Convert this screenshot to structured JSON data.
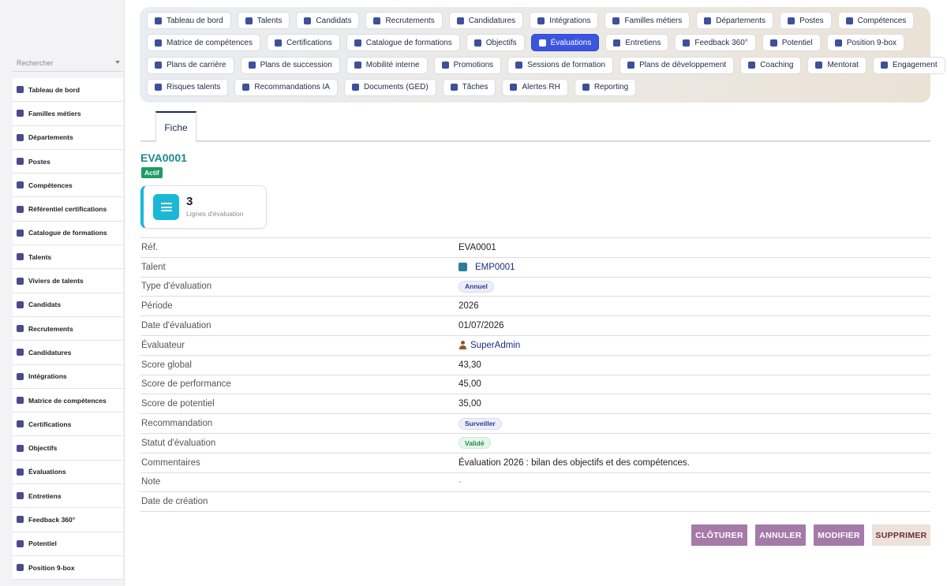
{
  "sidebar": {
    "search_placeholder": "Rechercher",
    "items": [
      {
        "label": "Tableau de bord",
        "icon": "dashboard-icon"
      },
      {
        "label": "Familles métiers",
        "icon": "sitemap-icon"
      },
      {
        "label": "Départements",
        "icon": "building-icon"
      },
      {
        "label": "Postes",
        "icon": "id-badge-icon"
      },
      {
        "label": "Compétences",
        "icon": "brain-icon"
      },
      {
        "label": "Référentiel certifications",
        "icon": "certificate-icon"
      },
      {
        "label": "Catalogue de formations",
        "icon": "graduation-cap-icon"
      },
      {
        "label": "Talents",
        "icon": "user-icon"
      },
      {
        "label": "Viviers de talents",
        "icon": "layers-icon"
      },
      {
        "label": "Candidats",
        "icon": "user-plus-icon"
      },
      {
        "label": "Recrutements",
        "icon": "megaphone-icon"
      },
      {
        "label": "Candidatures",
        "icon": "file-signature-icon"
      },
      {
        "label": "Intégrations",
        "icon": "door-icon"
      },
      {
        "label": "Matrice de compétences",
        "icon": "sitemap-icon"
      },
      {
        "label": "Certifications",
        "icon": "award-icon"
      },
      {
        "label": "Objectifs",
        "icon": "target-icon"
      },
      {
        "label": "Évaluations",
        "icon": "star-icon"
      },
      {
        "label": "Entretiens",
        "icon": "comments-icon"
      },
      {
        "label": "Feedback 360°",
        "icon": "comment-icon"
      },
      {
        "label": "Potentiel",
        "icon": "chart-line-icon"
      },
      {
        "label": "Position 9-box",
        "icon": "grid-icon"
      }
    ]
  },
  "chipnav": {
    "rows": [
      [
        {
          "label": "Tableau de bord",
          "icon": "dashboard-icon"
        },
        {
          "label": "Talents",
          "icon": "user-icon"
        },
        {
          "label": "Candidats",
          "icon": "user-plus-icon"
        },
        {
          "label": "Recrutements",
          "icon": "megaphone-icon"
        },
        {
          "label": "Candidatures",
          "icon": "file-signature-icon"
        },
        {
          "label": "Intégrations",
          "icon": "door-icon"
        },
        {
          "label": "Familles métiers",
          "icon": "sitemap-icon"
        },
        {
          "label": "Départements",
          "icon": "building-icon"
        },
        {
          "label": "Postes",
          "icon": "id-badge-icon"
        },
        {
          "label": "Compétences",
          "icon": "brain-icon"
        }
      ],
      [
        {
          "label": "Matrice de compétences",
          "icon": "sitemap-icon"
        },
        {
          "label": "Certifications",
          "icon": "award-icon"
        },
        {
          "label": "Catalogue de formations",
          "icon": "graduation-cap-icon"
        },
        {
          "label": "Objectifs",
          "icon": "target-icon"
        },
        {
          "label": "Évaluations",
          "icon": "star-icon",
          "active": true
        },
        {
          "label": "Entretiens",
          "icon": "comments-icon"
        },
        {
          "label": "Feedback 360°",
          "icon": "comment-icon"
        },
        {
          "label": "Potentiel",
          "icon": "chart-line-icon"
        },
        {
          "label": "Position 9-box",
          "icon": "grid-icon"
        }
      ],
      [
        {
          "label": "Plans de carrière",
          "icon": "route-icon"
        },
        {
          "label": "Plans de succession",
          "icon": "sitemap-icon"
        },
        {
          "label": "Mobilité interne",
          "icon": "exchange-icon"
        },
        {
          "label": "Promotions",
          "icon": "arrow-up-icon"
        },
        {
          "label": "Sessions de formation",
          "icon": "chalkboard-icon"
        },
        {
          "label": "Plans de développement",
          "icon": "clipboard-icon"
        },
        {
          "label": "Coaching",
          "icon": "handshake-icon"
        },
        {
          "label": "Mentorat",
          "icon": "user-tie-icon"
        },
        {
          "label": "Engagement",
          "icon": "heart-icon"
        }
      ],
      [
        {
          "label": "Risques talents",
          "icon": "warning-icon"
        },
        {
          "label": "Recommandations IA",
          "icon": "robot-icon"
        },
        {
          "label": "Documents (GED)",
          "icon": "folder-icon"
        },
        {
          "label": "Tâches",
          "icon": "tasks-icon"
        },
        {
          "label": "Alertes RH",
          "icon": "bell-icon"
        },
        {
          "label": "Reporting",
          "icon": "pie-chart-icon"
        }
      ]
    ]
  },
  "tabs": {
    "fiche": "Fiche"
  },
  "record": {
    "id": "EVA0001",
    "status": "Actif",
    "kpi": {
      "value": "3",
      "label": "Lignes d'évaluation"
    }
  },
  "details": {
    "ref": {
      "label": "Réf.",
      "value": "EVA0001"
    },
    "talent": {
      "label": "Talent",
      "value": "EMP0001"
    },
    "type": {
      "label": "Type d'évaluation",
      "value": "Annuel"
    },
    "periode": {
      "label": "Période",
      "value": "2026"
    },
    "date": {
      "label": "Date d'évaluation",
      "value": "01/07/2026"
    },
    "evaluateur": {
      "label": "Évaluateur",
      "value": "SuperAdmin"
    },
    "score_global": {
      "label": "Score global",
      "value": "43,30"
    },
    "score_perf": {
      "label": "Score de performance",
      "value": "45,00"
    },
    "score_pot": {
      "label": "Score de potentiel",
      "value": "35,00"
    },
    "recommandation": {
      "label": "Recommandation",
      "value": "Surveiller"
    },
    "statut": {
      "label": "Statut d'évaluation",
      "value": "Validé"
    },
    "commentaires": {
      "label": "Commentaires",
      "value": "Évaluation 2026 : bilan des objectifs et des compétences."
    },
    "note": {
      "label": "Note",
      "value": "-"
    },
    "date_creation": {
      "label": "Date de création",
      "value": ""
    }
  },
  "actions": {
    "cloturer": "CLÔTURER",
    "annuler": "ANNULER",
    "modifier": "MODIFIER",
    "supprimer": "SUPPRIMER"
  }
}
